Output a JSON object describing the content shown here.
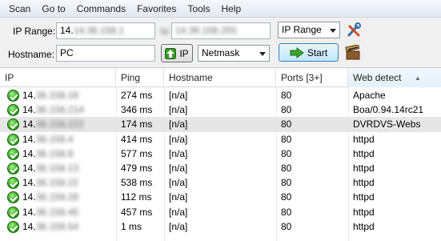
{
  "menu": [
    "Scan",
    "Go to",
    "Commands",
    "Favorites",
    "Tools",
    "Help"
  ],
  "toolbar": {
    "ip_range_label": "IP Range:",
    "ip_from": "14.36.158.1",
    "to_label": "to",
    "ip_to": "14.36.158.255",
    "range_type": "IP Range",
    "hostname_label": "Hostname:",
    "hostname": "PC",
    "ip_button": "IP",
    "netmask": "Netmask",
    "start_button": "Start"
  },
  "table": {
    "columns": [
      "IP",
      "Ping",
      "Hostname",
      "Ports [3+]",
      "Web detect"
    ],
    "rows": [
      {
        "ip_prefix": "14.",
        "ip_rest": "36.158.18",
        "ping": "274 ms",
        "hostname": "[n/a]",
        "ports": "80",
        "web": "Apache"
      },
      {
        "ip_prefix": "14.",
        "ip_rest": "36.158.214",
        "ping": "346 ms",
        "hostname": "[n/a]",
        "ports": "80",
        "web": "Boa/0.94.14rc21"
      },
      {
        "ip_prefix": "14.",
        "ip_rest": "36.158.222",
        "ping": "174 ms",
        "hostname": "[n/a]",
        "ports": "80",
        "web": "DVRDVS-Webs"
      },
      {
        "ip_prefix": "14.",
        "ip_rest": "36.158.4",
        "ping": "414 ms",
        "hostname": "[n/a]",
        "ports": "80",
        "web": "httpd"
      },
      {
        "ip_prefix": "14.",
        "ip_rest": "36.158.8",
        "ping": "577 ms",
        "hostname": "[n/a]",
        "ports": "80",
        "web": "httpd"
      },
      {
        "ip_prefix": "14.",
        "ip_rest": "36.158.13",
        "ping": "479 ms",
        "hostname": "[n/a]",
        "ports": "80",
        "web": "httpd"
      },
      {
        "ip_prefix": "14.",
        "ip_rest": "36.158.22",
        "ping": "538 ms",
        "hostname": "[n/a]",
        "ports": "80",
        "web": "httpd"
      },
      {
        "ip_prefix": "14.",
        "ip_rest": "36.158.28",
        "ping": "112 ms",
        "hostname": "[n/a]",
        "ports": "80",
        "web": "httpd"
      },
      {
        "ip_prefix": "14.",
        "ip_rest": "36.158.45",
        "ping": "457 ms",
        "hostname": "[n/a]",
        "ports": "80",
        "web": "httpd"
      },
      {
        "ip_prefix": "14.",
        "ip_rest": "36.158.54",
        "ping": "1 ms",
        "hostname": "[n/a]",
        "ports": "80",
        "web": "httpd"
      }
    ]
  }
}
